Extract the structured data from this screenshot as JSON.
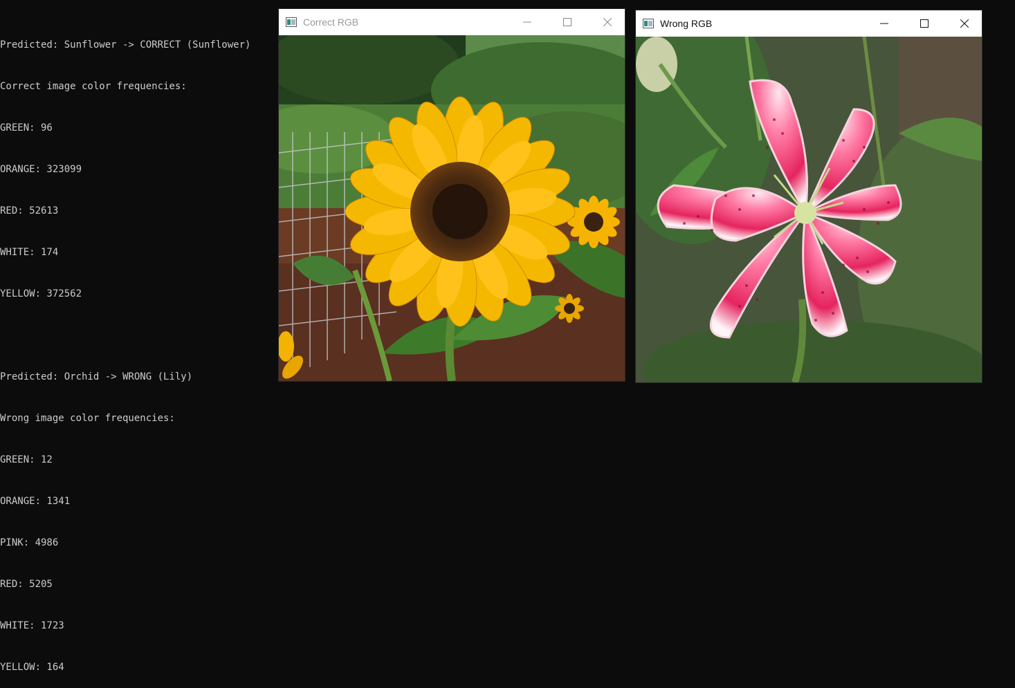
{
  "console": {
    "lines": [
      "Predicted: Sunflower -> CORRECT (Sunflower)",
      "Correct image color frequencies:",
      "GREEN: 96",
      "ORANGE: 323099",
      "RED: 52613",
      "WHITE: 174",
      "YELLOW: 372562",
      "",
      "Predicted: Orchid -> WRONG (Lily)",
      "Wrong image color frequencies:",
      "GREEN: 12",
      "ORANGE: 1341",
      "PINK: 4986",
      "RED: 5205",
      "WHITE: 1723",
      "YELLOW: 164"
    ]
  },
  "windows": {
    "correct": {
      "title": "Correct RGB",
      "image_alt": "sunflower",
      "title_color": "#999999"
    },
    "wrong": {
      "title": "Wrong RGB",
      "image_alt": "lily",
      "title_color": "#111111"
    }
  },
  "icons": {
    "app": "opencv-window-icon",
    "minimize": "minimize-icon",
    "maximize": "maximize-icon",
    "close": "close-icon"
  },
  "colors": {
    "console_bg": "#0c0c0c",
    "console_text": "#cccccc",
    "titlebar_bg": "#ffffff"
  }
}
